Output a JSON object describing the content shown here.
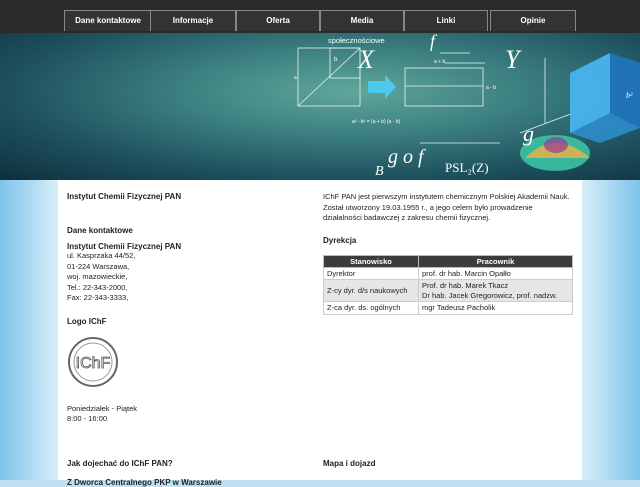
{
  "nav": {
    "items": [
      {
        "label": "Dane kontaktowe"
      },
      {
        "label": "Informacje"
      },
      {
        "label": "Oferta"
      },
      {
        "label": "Media"
      },
      {
        "label": "Linki"
      },
      {
        "label": "Opinie"
      }
    ]
  },
  "banner": {
    "sub_label": "społecznościowe",
    "formula_1": "a² - b²   =   (a + b) (a - b)",
    "formula_2": "g o f",
    "formula_3": "PSL₂(Z)",
    "sym_x": "X",
    "sym_y": "Y",
    "sym_f": "f",
    "sym_g": "g",
    "sym_b": "B",
    "lbl_a": "a",
    "lbl_b": "b",
    "lbl_apb": "a + b",
    "lbl_amb": "a - b",
    "lbl_b2": "b²"
  },
  "left": {
    "title": "Instytut Chemii Fizycznej PAN",
    "contact_heading": "Dane kontaktowe",
    "org_name": "Instytut Chemii Fizycznej PAN",
    "address_1": "ul. Kasprzaka 44/52,",
    "address_2": "01-224 Warszawa,",
    "address_3": "woj. mazowieckie,",
    "phone": "Tel.: 22-343-2000,",
    "fax": "Fax: 22-343-3333,",
    "logo_heading": "Logo IChF",
    "logo_text": "IChF",
    "hours_days": "Poniedziałek - Piątek",
    "hours_time": "8:00 - 16:00",
    "directions_heading": "Jak dojechać do IChF PAN?",
    "directions_partial": "Z Dworca Centralnego PKP w Warszawie"
  },
  "right": {
    "intro": "IChF PAN jest pierwszym instytutem chemicznym Polskiej Akademii Nauk. Został utworzony 19.03.1955 r., a jego celem było prowadzenie działalności badawczej z zakresu chemii fizycznej.",
    "board_heading": "Dyrekcja",
    "table": {
      "headers": [
        "Stanowisko",
        "Pracownik"
      ],
      "rows": [
        {
          "role": "Dyrektor",
          "person": "prof. dr hab. Marcin Opałło",
          "person2": ""
        },
        {
          "role": "Z-cy dyr. d/s naukowych",
          "person": "Prof. dr hab. Marek Tkacz",
          "person2": "Dr hab. Jacek Gregorowicz, prof. nadzw."
        },
        {
          "role": "Z-ca dyr. ds. ogólnych",
          "person": "mgr Tadeusz Pacholik",
          "person2": ""
        }
      ]
    },
    "map_heading": "Mapa i dojazd"
  }
}
